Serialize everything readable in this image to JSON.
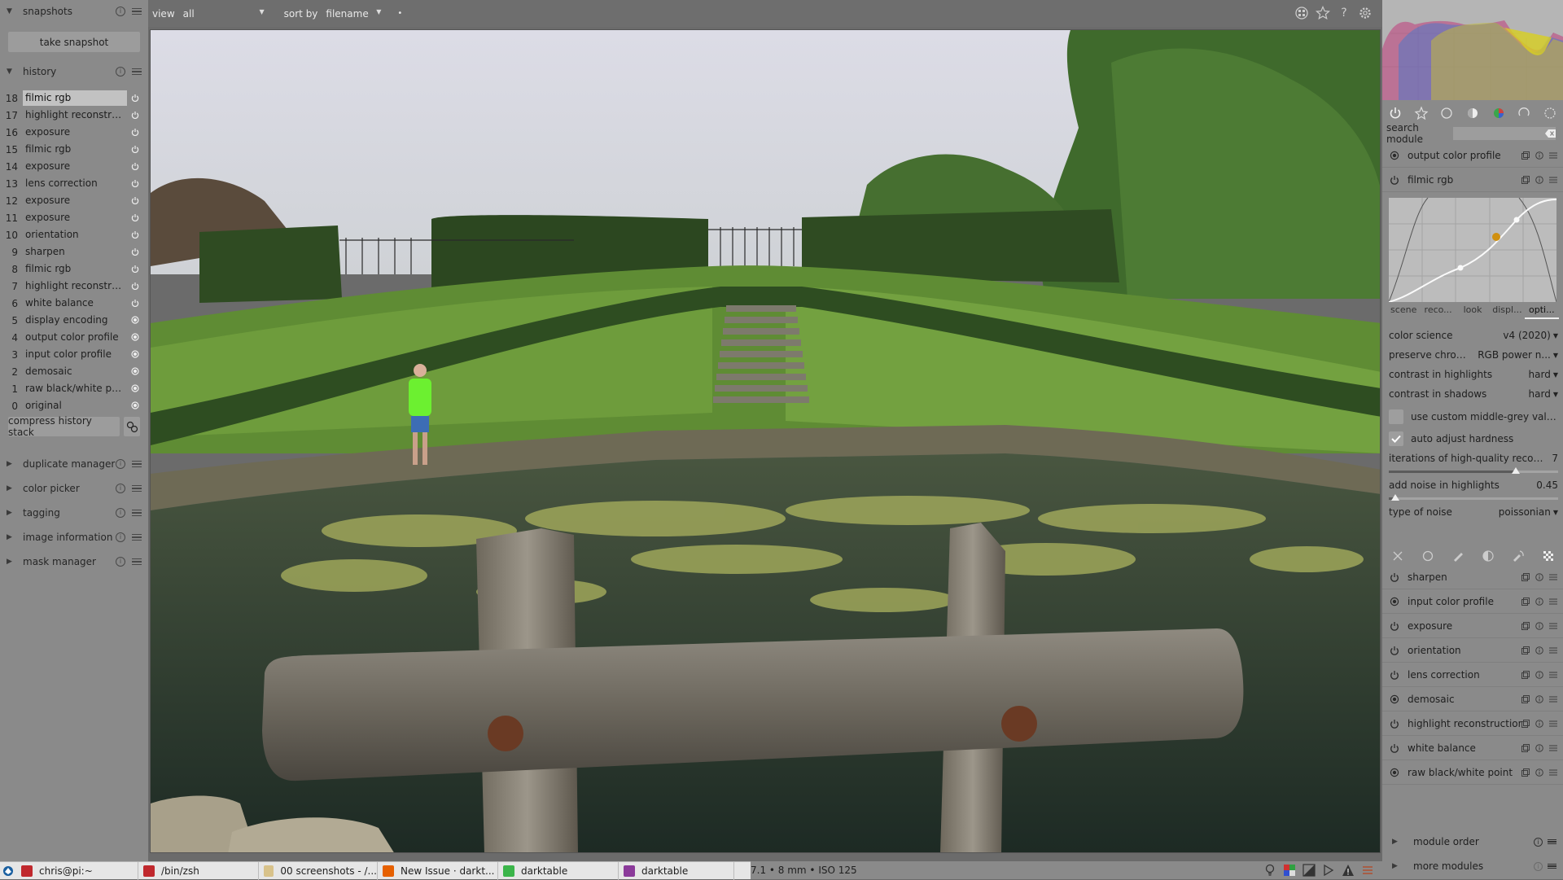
{
  "left": {
    "snapshots": {
      "title": "snapshots",
      "take_label": "take snapshot"
    },
    "history": {
      "title": "history",
      "items": [
        {
          "num": "18",
          "label": "filmic rgb",
          "selected": true,
          "state": "on"
        },
        {
          "num": "17",
          "label": "highlight reconstructi...",
          "state": "on"
        },
        {
          "num": "16",
          "label": "exposure",
          "state": "on"
        },
        {
          "num": "15",
          "label": "filmic rgb",
          "state": "on"
        },
        {
          "num": "14",
          "label": "exposure",
          "state": "on"
        },
        {
          "num": "13",
          "label": "lens correction",
          "state": "on"
        },
        {
          "num": "12",
          "label": "exposure",
          "state": "on"
        },
        {
          "num": "11",
          "label": "exposure",
          "state": "on"
        },
        {
          "num": "10",
          "label": "orientation",
          "state": "on"
        },
        {
          "num": "9",
          "label": "sharpen",
          "state": "on"
        },
        {
          "num": "8",
          "label": "filmic rgb",
          "state": "on"
        },
        {
          "num": "7",
          "label": "highlight reconstructi...",
          "state": "on"
        },
        {
          "num": "6",
          "label": "white balance",
          "state": "on"
        },
        {
          "num": "5",
          "label": "display encoding",
          "state": "always"
        },
        {
          "num": "4",
          "label": "output color profile",
          "state": "always"
        },
        {
          "num": "3",
          "label": "input color profile",
          "state": "always"
        },
        {
          "num": "2",
          "label": "demosaic",
          "state": "always"
        },
        {
          "num": "1",
          "label": "raw black/white point",
          "state": "always"
        },
        {
          "num": "0",
          "label": "original",
          "state": "always"
        }
      ],
      "compress_label": "compress history stack"
    },
    "collapsed": [
      "duplicate manager",
      "color picker",
      "tagging",
      "image information",
      "mask manager"
    ]
  },
  "topbar": {
    "view_label": "view",
    "view_value": "all",
    "sort_label": "sort by",
    "sort_value": "filename",
    "icons": [
      "grouping-icon",
      "star-icon",
      "help-icon",
      "gear-icon"
    ]
  },
  "right": {
    "search_label": "search module",
    "search_placeholder": "",
    "top_modules": [
      "output color profile",
      "filmic rgb"
    ],
    "filmic": {
      "tabs": [
        "scene",
        "reco...",
        "look",
        "displ...",
        "opti..."
      ],
      "active_tab": 4,
      "params": [
        {
          "label": "color science",
          "value": "v4 (2020)"
        },
        {
          "label": "preserve chromi...",
          "value": "RGB power n..."
        },
        {
          "label": "contrast in highlights",
          "value": "hard"
        },
        {
          "label": "contrast in shadows",
          "value": "hard"
        }
      ],
      "custom_grey_label": "use custom middle-grey values",
      "custom_grey_checked": false,
      "auto_hardness_label": "auto adjust hardness",
      "auto_hardness_checked": true,
      "iterations": {
        "label": "iterations of high-quality recon...",
        "value": "7",
        "fraction": 0.75
      },
      "noise": {
        "label": "add noise in highlights",
        "value": "0.45",
        "fraction": 0.04
      },
      "noise_type": {
        "label": "type of noise",
        "value": "poissonian"
      }
    },
    "modules": [
      {
        "label": "sharpen",
        "state": "on"
      },
      {
        "label": "input color profile",
        "state": "always"
      },
      {
        "label": "exposure",
        "state": "on"
      },
      {
        "label": "orientation",
        "state": "on"
      },
      {
        "label": "lens correction",
        "state": "on"
      },
      {
        "label": "demosaic",
        "state": "always"
      },
      {
        "label": "highlight reconstruction",
        "state": "on"
      },
      {
        "label": "white balance",
        "state": "on"
      },
      {
        "label": "raw black/white point",
        "state": "always"
      }
    ],
    "footer": [
      "module order",
      "more modules"
    ]
  },
  "status": {
    "text": "7.1 • 8 mm • ISO 125"
  },
  "taskbar": {
    "tasks": [
      {
        "label": "chris@pi:~",
        "color": "#c0282d"
      },
      {
        "label": "/bin/zsh",
        "color": "#c0282d"
      },
      {
        "label": "00 screenshots - /...",
        "color": "#d8c28a"
      },
      {
        "label": "New Issue · darkt...",
        "color": "#e66000"
      },
      {
        "label": "darktable",
        "color": "#3bb54a"
      },
      {
        "label": "darktable",
        "color": "#8b3a9a"
      }
    ]
  },
  "colors": {
    "panel": "#8a8a8a",
    "topbar": "#6e6e6e",
    "accent_curve": "#d09010"
  }
}
